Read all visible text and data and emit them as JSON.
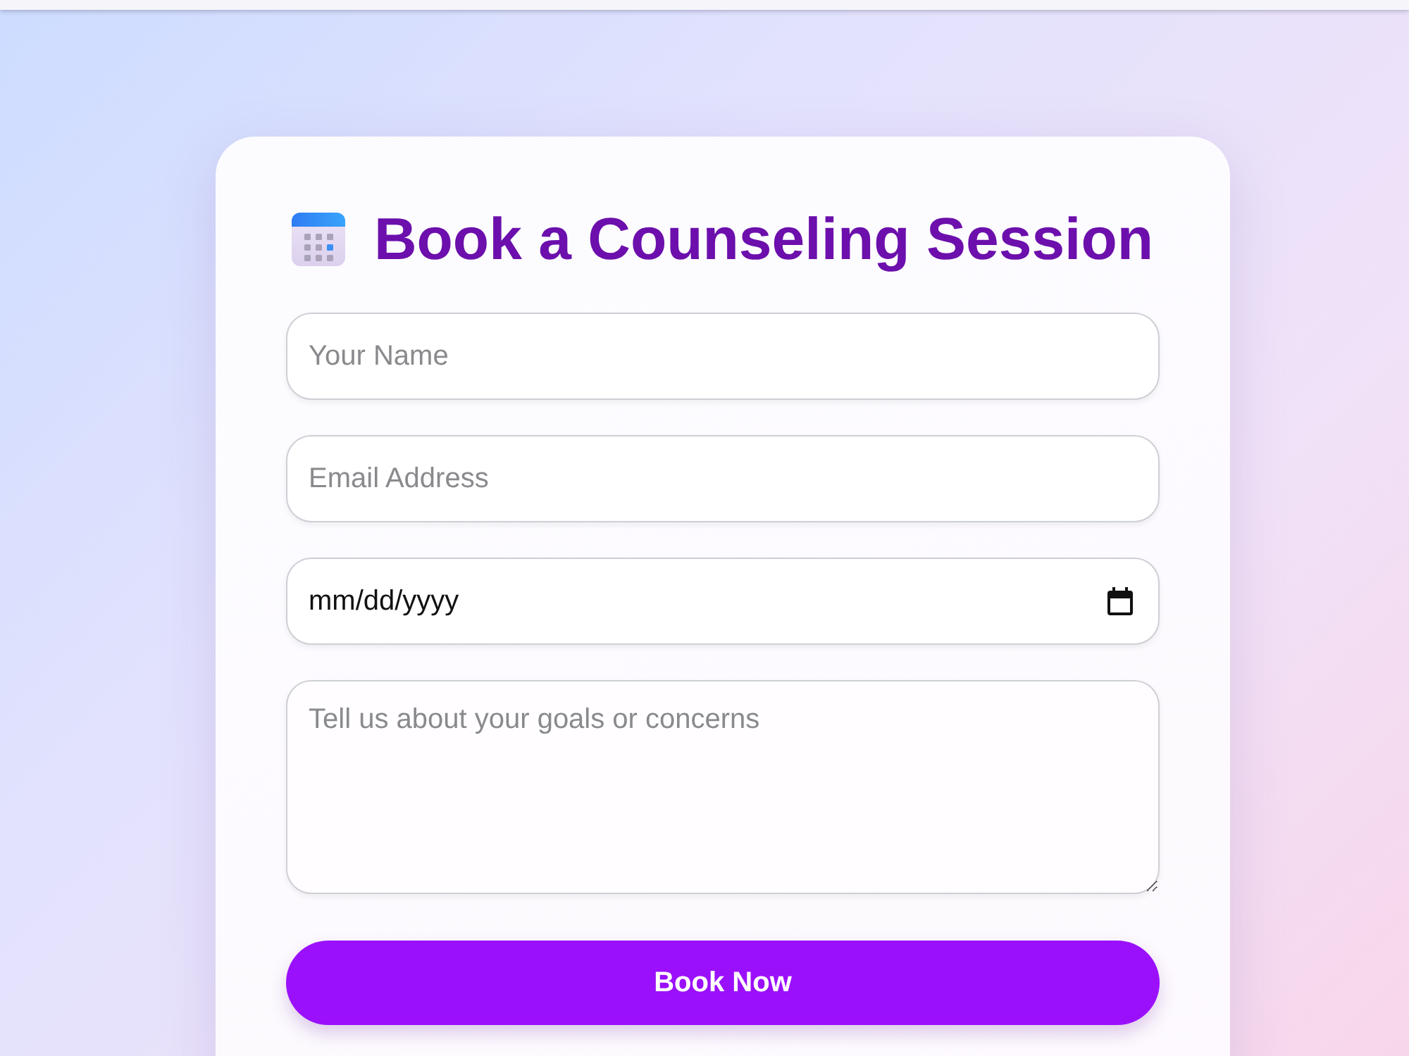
{
  "form": {
    "title": "Book a Counseling Session",
    "fields": [
      {
        "kind": "text",
        "placeholder": "Your Name"
      },
      {
        "kind": "email",
        "placeholder": "Email Address"
      },
      {
        "kind": "date",
        "placeholder": "mm/dd/yyyy"
      },
      {
        "kind": "textarea",
        "placeholder": "Tell us about your goals or concerns"
      }
    ],
    "submit_button": "Book Now"
  }
}
